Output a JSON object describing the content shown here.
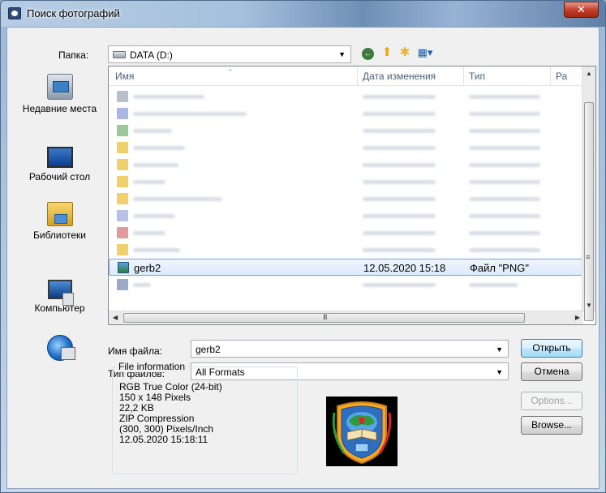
{
  "window": {
    "title": "Поиск фотографий",
    "close_glyph": "✕"
  },
  "toolbar": {
    "folder_label": "Папка:",
    "folder_value": "DATA (D:)",
    "back_icon": "←",
    "up_icon": "⬆",
    "newfolder_icon": "✱",
    "view_icon": "▦▾"
  },
  "places": [
    {
      "label": "Недавние места",
      "icon": "recent-places-icon"
    },
    {
      "label": "Рабочий стол",
      "icon": "desktop-icon"
    },
    {
      "label": "Библиотеки",
      "icon": "libraries-icon"
    },
    {
      "label": "Компьютер",
      "icon": "computer-icon"
    },
    {
      "label": "",
      "icon": "network-icon"
    }
  ],
  "columns": [
    "Имя",
    "Дата изменения",
    "Тип",
    "Ра"
  ],
  "files": [
    {
      "name": "gerb2",
      "date": "12.05.2020 15:18",
      "type": "Файл \"PNG\"",
      "selected": true
    }
  ],
  "file_name": {
    "label": "Имя файла:",
    "value": "gerb2"
  },
  "file_type": {
    "label": "Тип файлов:",
    "value": "All Formats"
  },
  "buttons": {
    "open": "Открыть",
    "cancel": "Отмена",
    "options": "Options...",
    "browse": "Browse..."
  },
  "file_info": {
    "title": "File information",
    "lines": [
      "RGB True Color (24-bit)",
      "150 x 148 Pixels",
      "22,2 KB",
      "ZIP Compression",
      "(300, 300) Pixels/Inch",
      "12.05.2020  15:18:11"
    ]
  },
  "scroll_glyphs": {
    "up": "▲",
    "down": "▼",
    "left": "◀",
    "right": "▶",
    "vgrip": "≡",
    "hgrip": "III",
    "combo": "▼"
  },
  "colors": {
    "selection": "#dcebfc",
    "selection_border": "#7da2ce",
    "primary_button": "#bee6fd"
  }
}
